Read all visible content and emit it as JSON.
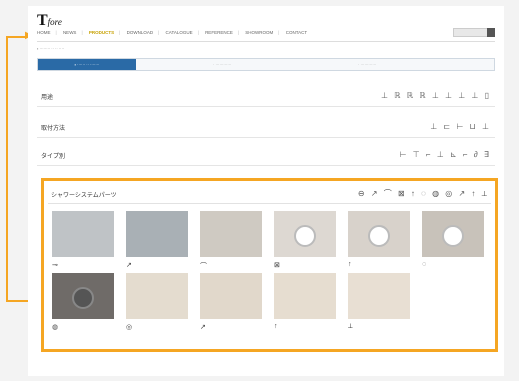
{
  "brand": {
    "logo_main": "T",
    "logo_sub": "fore"
  },
  "nav": [
    {
      "label": "HOME",
      "active": false
    },
    {
      "label": "NEWS",
      "active": false
    },
    {
      "label": "PRODUCTS",
      "active": true
    },
    {
      "label": "DOWNLOAD",
      "active": false
    },
    {
      "label": "CATALOGUE",
      "active": false
    },
    {
      "label": "REFERENCE",
      "active": false
    },
    {
      "label": "SHOWROOM",
      "active": false
    },
    {
      "label": "CONTACT",
      "active": false
    }
  ],
  "filters": {
    "row1": {
      "label": "用途"
    },
    "row2": {
      "label": "取付方法"
    },
    "row3": {
      "label": "タイプ別"
    }
  },
  "parts": {
    "label": "シャワーシステムパーツ"
  },
  "products": [
    {
      "caption": ""
    },
    {
      "caption": ""
    },
    {
      "caption": ""
    },
    {
      "caption": ""
    },
    {
      "caption": ""
    },
    {
      "caption": ""
    },
    {
      "caption": ""
    },
    {
      "caption": ""
    },
    {
      "caption": ""
    },
    {
      "caption": ""
    },
    {
      "caption": ""
    }
  ],
  "colors": {
    "accent": "#f5a623",
    "tab_active": "#2a6aa6"
  }
}
